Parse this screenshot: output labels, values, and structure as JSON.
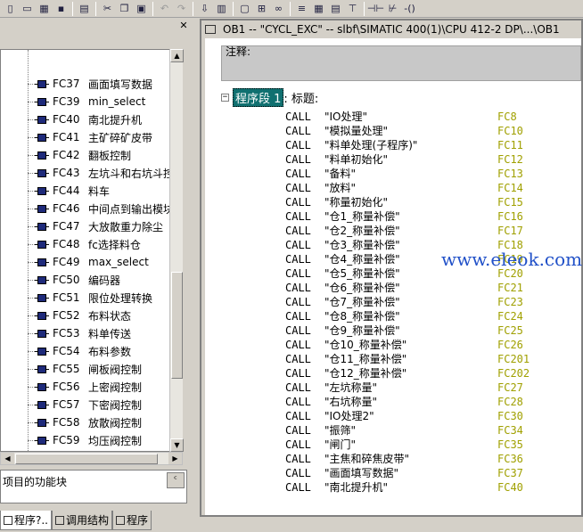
{
  "toolbar": {
    "buttons": [
      {
        "name": "new-icon",
        "glyph": "▯"
      },
      {
        "name": "open-icon",
        "glyph": "▭"
      },
      {
        "name": "online-icon",
        "glyph": "▦"
      },
      {
        "name": "save-icon",
        "glyph": "▪"
      },
      {
        "name": "print-icon",
        "glyph": "▤"
      },
      {
        "name": "cut-icon",
        "glyph": "✂"
      },
      {
        "name": "copy-icon",
        "glyph": "❐"
      },
      {
        "name": "paste-icon",
        "glyph": "▣"
      },
      {
        "name": "undo-icon",
        "glyph": "↶"
      },
      {
        "name": "redo-icon",
        "glyph": "↷"
      },
      {
        "name": "download-icon",
        "glyph": "⇩"
      },
      {
        "name": "monitor-icon",
        "glyph": "▥"
      },
      {
        "name": "window-icon",
        "glyph": "▢"
      },
      {
        "name": "network-icon",
        "glyph": "⊞"
      },
      {
        "name": "glasses-icon",
        "glyph": "∞"
      },
      {
        "name": "overview-icon",
        "glyph": "≡"
      },
      {
        "name": "layout-icon",
        "glyph": "▦"
      },
      {
        "name": "details-icon",
        "glyph": "▤"
      },
      {
        "name": "tree-icon",
        "glyph": "⊤"
      },
      {
        "name": "contact-no-icon",
        "glyph": "⊣⊢"
      },
      {
        "name": "contact-nc-icon",
        "glyph": "⊬"
      },
      {
        "name": "coil-icon",
        "glyph": "-()"
      }
    ]
  },
  "tree": {
    "items": [
      {
        "num": "FC37",
        "name": "画面填写数据"
      },
      {
        "num": "FC39",
        "name": "min_select"
      },
      {
        "num": "FC40",
        "name": "南北提升机"
      },
      {
        "num": "FC41",
        "name": "主矿碎矿皮带"
      },
      {
        "num": "FC42",
        "name": "翻板控制"
      },
      {
        "num": "FC43",
        "name": "左坑斗和右坑斗控"
      },
      {
        "num": "FC44",
        "name": "料车"
      },
      {
        "num": "FC46",
        "name": "中间点到输出模块"
      },
      {
        "num": "FC47",
        "name": "大放散重力除尘"
      },
      {
        "num": "FC48",
        "name": "fc选择料仓"
      },
      {
        "num": "FC49",
        "name": "max_select"
      },
      {
        "num": "FC50",
        "name": "编码器"
      },
      {
        "num": "FC51",
        "name": "限位处理转换"
      },
      {
        "num": "FC52",
        "name": "布料状态"
      },
      {
        "num": "FC53",
        "name": "料单传送"
      },
      {
        "num": "FC54",
        "name": "布料参数"
      },
      {
        "num": "FC55",
        "name": "闸板阀控制"
      },
      {
        "num": "FC56",
        "name": "上密阀控制"
      },
      {
        "num": "FC57",
        "name": "下密阀控制"
      },
      {
        "num": "FC58",
        "name": "放散阀控制"
      },
      {
        "num": "FC59",
        "name": "均压阀控制"
      }
    ]
  },
  "info": {
    "text": "项目的功能块",
    "button": "ᶜ"
  },
  "tabs": [
    {
      "label": "程序?.."
    },
    {
      "label": "调用结构"
    },
    {
      "label": "程序"
    }
  ],
  "editor": {
    "title": "OB1 -- \"CYCL_EXC\" -- slbf\\SIMATIC 400(1)\\CPU 412-2 DP\\...\\OB1",
    "comment_label": "注释:",
    "network_label": "程序段 1",
    "network_title": ": 标题:",
    "code": [
      {
        "op": "CALL",
        "sym": "\"IO处理\"",
        "fc": "FC8"
      },
      {
        "op": "CALL",
        "sym": "\"模拟量处理\"",
        "fc": "FC10"
      },
      {
        "op": "CALL",
        "sym": "\"料单处理(子程序)\"",
        "fc": "FC11"
      },
      {
        "op": "CALL",
        "sym": "\"料单初始化\"",
        "fc": "FC12"
      },
      {
        "op": "CALL",
        "sym": "\"备料\"",
        "fc": "FC13"
      },
      {
        "op": "CALL",
        "sym": "\"放料\"",
        "fc": "FC14"
      },
      {
        "op": "CALL",
        "sym": "\"称量初始化\"",
        "fc": "FC15"
      },
      {
        "op": "CALL",
        "sym": "\"仓1_称量补偿\"",
        "fc": "FC16"
      },
      {
        "op": "CALL",
        "sym": "\"仓2_称量补偿\"",
        "fc": "FC17"
      },
      {
        "op": "CALL",
        "sym": "\"仓3_称量补偿\"",
        "fc": "FC18"
      },
      {
        "op": "CALL",
        "sym": "\"仓4_称量补偿\"",
        "fc": "FC19"
      },
      {
        "op": "CALL",
        "sym": "\"仓5_称量补偿\"",
        "fc": "FC20"
      },
      {
        "op": "CALL",
        "sym": "\"仓6_称量补偿\"",
        "fc": "FC21"
      },
      {
        "op": "CALL",
        "sym": "\"仓7_称量补偿\"",
        "fc": "FC23"
      },
      {
        "op": "CALL",
        "sym": "\"仓8_称量补偿\"",
        "fc": "FC24"
      },
      {
        "op": "CALL",
        "sym": "\"仓9_称量补偿\"",
        "fc": "FC25"
      },
      {
        "op": "CALL",
        "sym": "\"仓10_称量补偿\"",
        "fc": "FC26"
      },
      {
        "op": "CALL",
        "sym": "\"仓11_称量补偿\"",
        "fc": "FC201"
      },
      {
        "op": "CALL",
        "sym": "\"仓12_称量补偿\"",
        "fc": "FC202"
      },
      {
        "op": "CALL",
        "sym": "\"左坑称量\"",
        "fc": "FC27"
      },
      {
        "op": "CALL",
        "sym": "\"右坑称量\"",
        "fc": "FC28"
      },
      {
        "op": "CALL",
        "sym": "\"IO处理2\"",
        "fc": "FC30"
      },
      {
        "op": "CALL",
        "sym": "\"振筛\"",
        "fc": "FC34"
      },
      {
        "op": "CALL",
        "sym": "\"闸门\"",
        "fc": "FC35"
      },
      {
        "op": "CALL",
        "sym": "\"主焦和碎焦皮带\"",
        "fc": "FC36"
      },
      {
        "op": "CALL",
        "sym": "\"画面填写数据\"",
        "fc": "FC37"
      },
      {
        "op": "CALL",
        "sym": "\"南北提升机\"",
        "fc": "FC40"
      }
    ]
  },
  "watermark": "www.eleok.com"
}
